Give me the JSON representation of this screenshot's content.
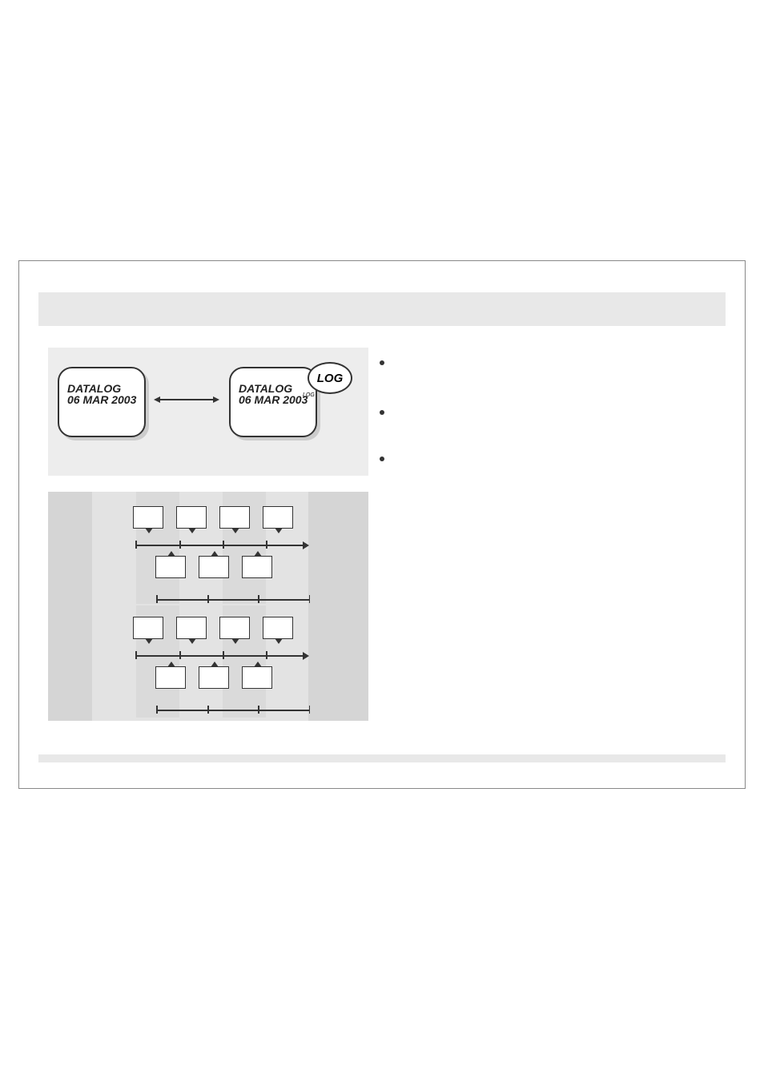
{
  "screens": {
    "line1": "DATALOG",
    "line2": "06 MAR 2003"
  },
  "log_bubble": "LOG",
  "log_small": "LOG"
}
